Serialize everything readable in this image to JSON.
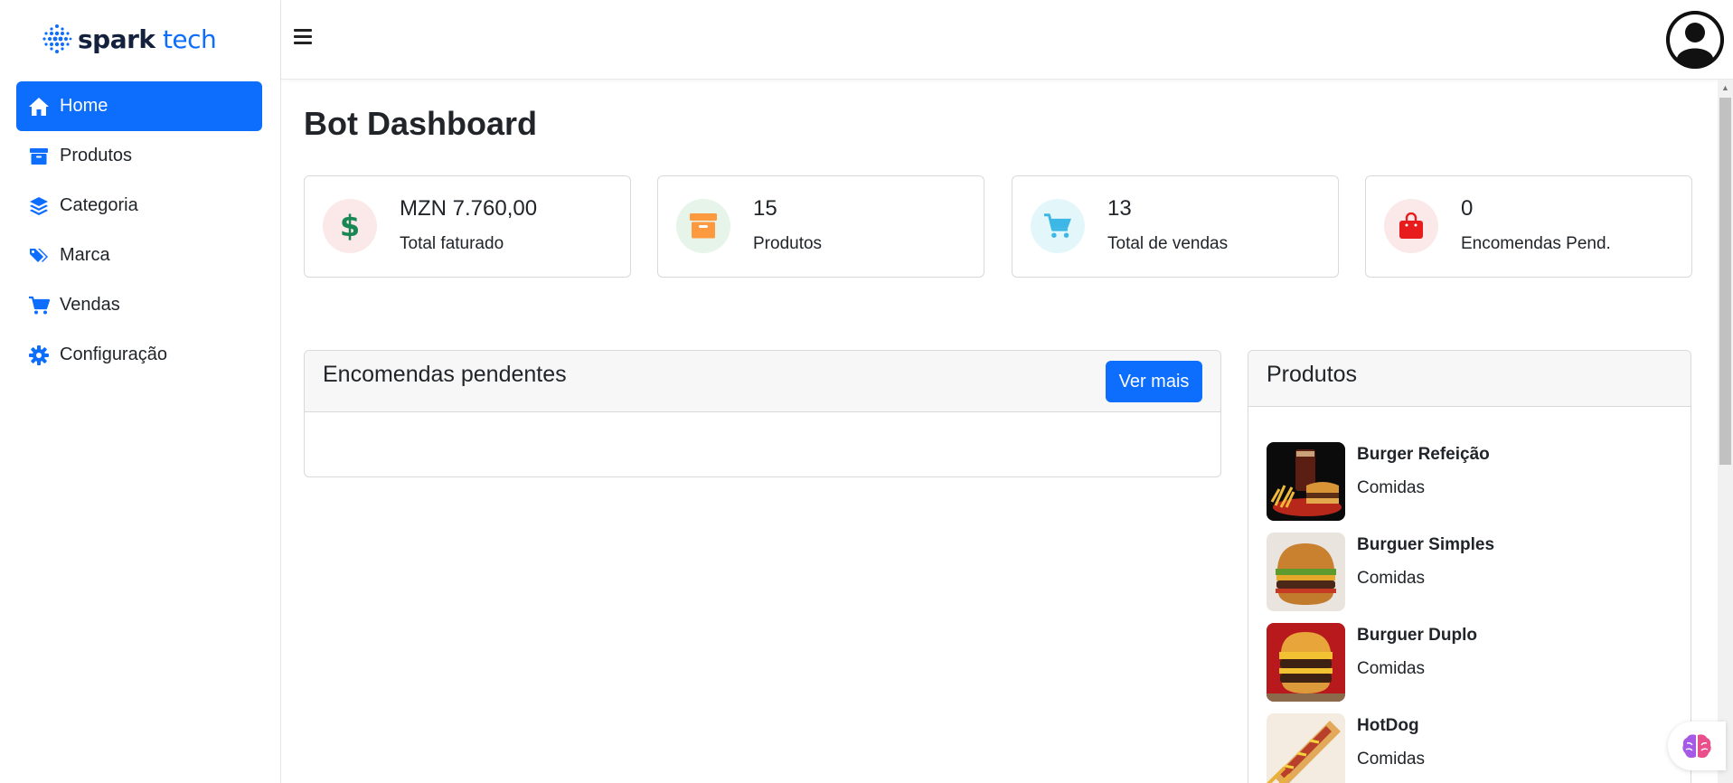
{
  "brand": {
    "name_bold": "spark",
    "name_light": "tech",
    "color": "#0d6efd"
  },
  "sidebar": {
    "items": [
      {
        "label": "Home",
        "icon": "home-icon",
        "active": true
      },
      {
        "label": "Produtos",
        "icon": "archive-box-icon",
        "active": false
      },
      {
        "label": "Categoria",
        "icon": "layers-icon",
        "active": false
      },
      {
        "label": "Marca",
        "icon": "tags-icon",
        "active": false
      },
      {
        "label": "Vendas",
        "icon": "cart-icon",
        "active": false
      },
      {
        "label": "Configuração",
        "icon": "gear-icon",
        "active": false
      }
    ]
  },
  "topbar": {
    "menu_icon": "hamburger-icon",
    "avatar_icon": "user-circle-icon"
  },
  "page": {
    "title": "Bot Dashboard"
  },
  "stats": [
    {
      "value": "MZN 7.760,00",
      "label": "Total faturado",
      "icon": "dollar-icon",
      "icon_color": "#198754",
      "bg": "#fbe9ea"
    },
    {
      "value": "15",
      "label": "Produtos",
      "icon": "archive-box-icon",
      "icon_color": "#fd7e14",
      "bg": "#e6f4ea"
    },
    {
      "value": "13",
      "label": "Total de vendas",
      "icon": "cart-icon",
      "icon_color": "#0dcaf0",
      "bg": "#e3f7fb"
    },
    {
      "value": "0",
      "label": "Encomendas Pend.",
      "icon": "shopping-bag-icon",
      "icon_color": "#dc3545",
      "bg": "#fbe9ea"
    }
  ],
  "pending_orders": {
    "title": "Encomendas pendentes",
    "button_label": "Ver mais"
  },
  "products_card": {
    "title": "Produtos",
    "items": [
      {
        "name": "Burger Refeição",
        "category": "Comidas"
      },
      {
        "name": "Burguer Simples",
        "category": "Comidas"
      },
      {
        "name": "Burguer Duplo",
        "category": "Comidas"
      },
      {
        "name": "HotDog",
        "category": "Comidas"
      }
    ]
  },
  "colors": {
    "primary": "#0d6efd",
    "text": "#212529",
    "border": "#d9d9d9"
  }
}
